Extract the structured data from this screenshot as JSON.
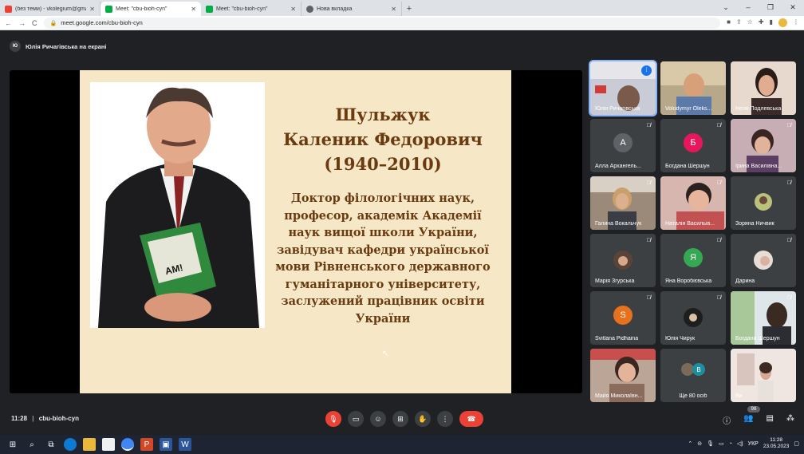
{
  "browser": {
    "tabs": [
      {
        "title": "(без теми) - vkolegium@gmail.c",
        "favicon_color": "#ea4335"
      },
      {
        "title": "Meet: \"cbu-bioh-cyn\"",
        "favicon_color": "#00ac47",
        "active": true
      },
      {
        "title": "Meet: \"cbu-bioh-cyn\"",
        "favicon_color": "#00ac47"
      },
      {
        "title": "Нова вкладка",
        "favicon_color": "#5f6368"
      }
    ],
    "new_tab": "+",
    "url": "meet.google.com/cbu-bioh-cyn"
  },
  "presenting": {
    "badge": "Ю",
    "text": "Юлія Ричагівська на екрані"
  },
  "slide": {
    "title_lines": [
      "Шульжук",
      "Каленик Федорович",
      "(1940–2010)"
    ],
    "body_lines": [
      "Доктор філологічних наук,",
      "професор, академік Академії",
      "наук вищої школи України,",
      "завідувач кафедри української",
      "мови Рівненського державного",
      "гуманітарного університету,",
      "заслужений працівник освіти",
      "України"
    ]
  },
  "participants": [
    {
      "name": "Юлія Ричагівська",
      "speaking": true
    },
    {
      "name": "Volodymyr Oleks..."
    },
    {
      "name": "Неля Подлевська"
    },
    {
      "name": "Алла Архангель...",
      "initial": "А",
      "color": "#5f6368"
    },
    {
      "name": "Богдана Шершун",
      "initial": "Б",
      "color": "#e8175d"
    },
    {
      "name": "Ірина Василівна..."
    },
    {
      "name": "Галина Вокальчук"
    },
    {
      "name": "Наталія Васильів..."
    },
    {
      "name": "Зоряна Ничвик"
    },
    {
      "name": "Марія Згурська"
    },
    {
      "name": "Яна Воробієвська",
      "initial": "Я",
      "color": "#34a853"
    },
    {
      "name": "Дарина"
    },
    {
      "name": "Svitlana Pidhaina",
      "initial": "S",
      "color": "#e8711c"
    },
    {
      "name": "Юлія Чирук"
    },
    {
      "name": "Богдана Шершун"
    },
    {
      "name": "Майя Миколаївн..."
    },
    {
      "name": "Ще 80 осіб"
    },
    {
      "name": "Ви"
    }
  ],
  "controls": {
    "time": "11:28",
    "meeting_code": "cbu-bioh-cyn",
    "people_count": "98"
  },
  "taskbar": {
    "lang": "УКР",
    "time": "11:28",
    "date": "23.05.2023"
  }
}
